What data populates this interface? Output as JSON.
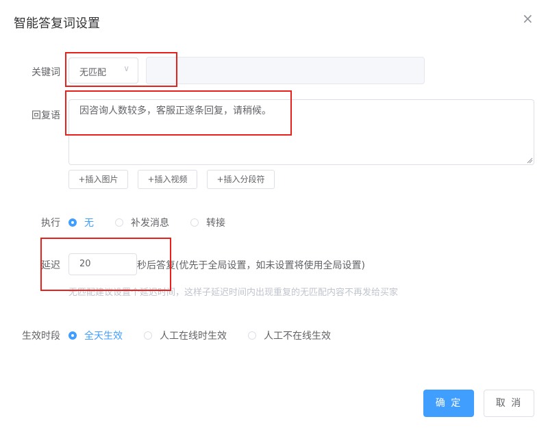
{
  "dialog": {
    "title": "智能答复词设置",
    "close_icon": "×"
  },
  "keyword": {
    "label": "关键词",
    "match_value": "无匹配",
    "chevron": "∨",
    "input_value": ""
  },
  "reply": {
    "label": "回复语",
    "text": "因咨询人数较多，客服正逐条回复，请稍候。",
    "buttons": [
      "+插入图片",
      "+插入视频",
      "+插入分段符"
    ]
  },
  "execute": {
    "label": "执行",
    "options": [
      "无",
      "补发消息",
      "转接"
    ],
    "selected": "无"
  },
  "delay": {
    "label": "延迟",
    "value": "20",
    "suffix": "秒后答复(优先于全局设置，如未设置将使用全局设置)",
    "hint": "无匹配建议设置个延迟时间，这样子延迟时间内出现重复的无匹配内容不再发给买家"
  },
  "effective": {
    "label": "生效时段",
    "options": [
      "全天生效",
      "人工在线时生效",
      "人工不在线生效"
    ],
    "selected": "全天生效"
  },
  "footer": {
    "confirm": "确 定",
    "cancel": "取 消"
  },
  "colors": {
    "primary": "#409eff",
    "annotation": "#e8201c"
  }
}
